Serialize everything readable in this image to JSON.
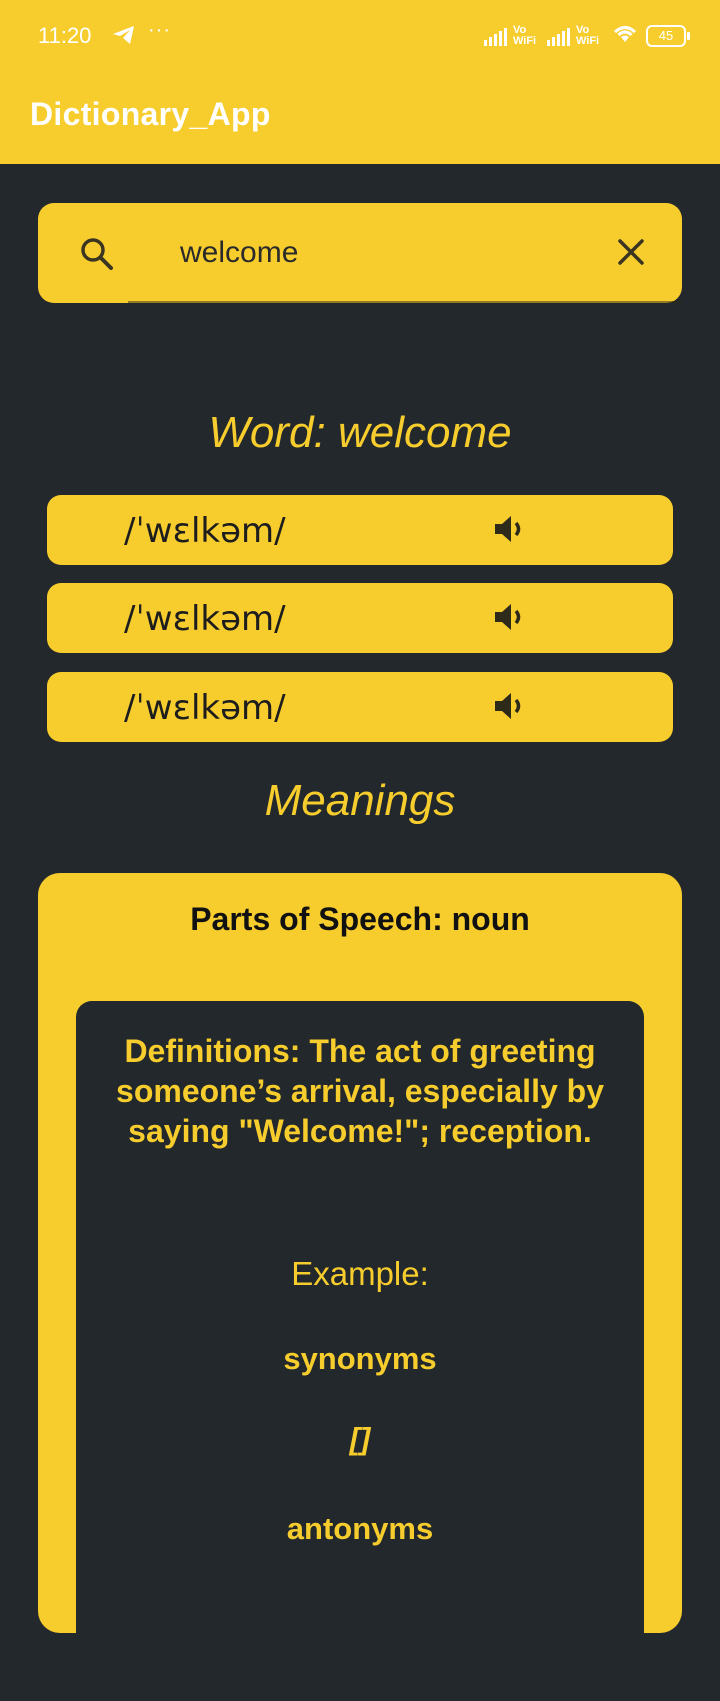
{
  "status_bar": {
    "time": "11:20",
    "wifi_label_1": "Vo WiFi",
    "wifi_label_2": "Vo WiFi",
    "battery": "45"
  },
  "app": {
    "title": "Dictionary_App"
  },
  "search": {
    "value": "welcome",
    "placeholder": ""
  },
  "word": {
    "title": "Word: welcome"
  },
  "phonetics": [
    {
      "text": "/ˈwɛlkəm/"
    },
    {
      "text": "/ˈwɛlkəm/"
    },
    {
      "text": "/ˈwɛlkəm/"
    }
  ],
  "meanings": {
    "title": "Meanings",
    "items": [
      {
        "part_of_speech": "Parts of Speech: noun",
        "definition": "Definitions: The act of greeting someone’s arrival, especially by saying \"Welcome!\"; reception.",
        "example_label": "Example:",
        "synonyms_label": "synonyms",
        "synonyms_value": "[]",
        "antonyms_label": "antonyms"
      }
    ]
  },
  "colors": {
    "accent": "#f7cd2e",
    "background": "#22282b"
  }
}
